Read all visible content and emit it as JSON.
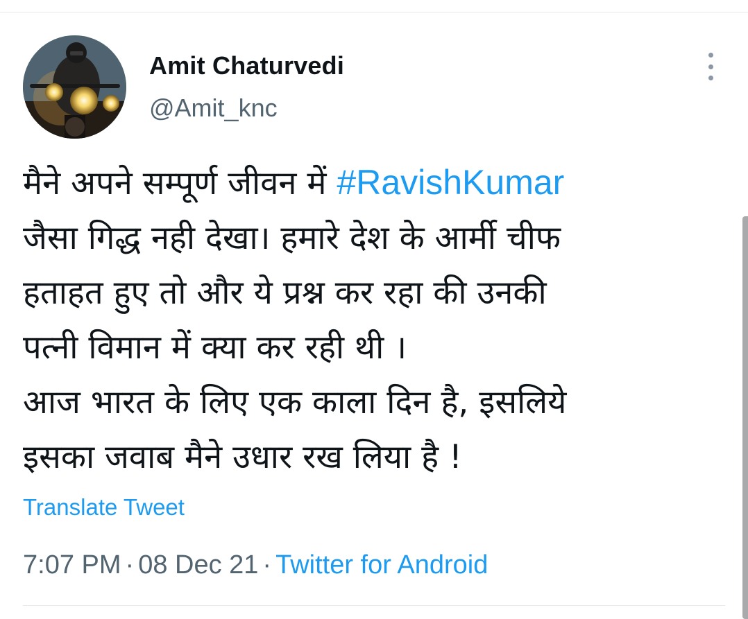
{
  "author": {
    "display_name": "Amit Chaturvedi",
    "handle": "@Amit_knc",
    "avatar_icon": "avatar-motorcycle-rider"
  },
  "more_menu": {
    "icon": "vertical-ellipsis-icon"
  },
  "tweet": {
    "line1": "मैने अपने सम्पूर्ण जीवन में ",
    "hashtag": "#RavishKumar",
    "line2": "जैसा गिद्ध नही देखा। हमारे देश के आर्मी चीफ",
    "line3": "हताहत हुए तो और ये प्रश्न कर रहा की उनकी",
    "line4": "पत्नी विमान में क्या कर रही थी ।",
    "line5": "आज भारत के लिए एक काला दिन है, इसलिये",
    "line6": "इसका जवाब मैने उधार रख लिया है !"
  },
  "translate_label": "Translate Tweet",
  "meta": {
    "time": "7:07 PM",
    "separator": "·",
    "date": "08 Dec 21",
    "source": "Twitter for Android"
  },
  "colors": {
    "link": "#1d9bf0",
    "secondary_text": "#536471",
    "primary_text": "#0f1419"
  }
}
